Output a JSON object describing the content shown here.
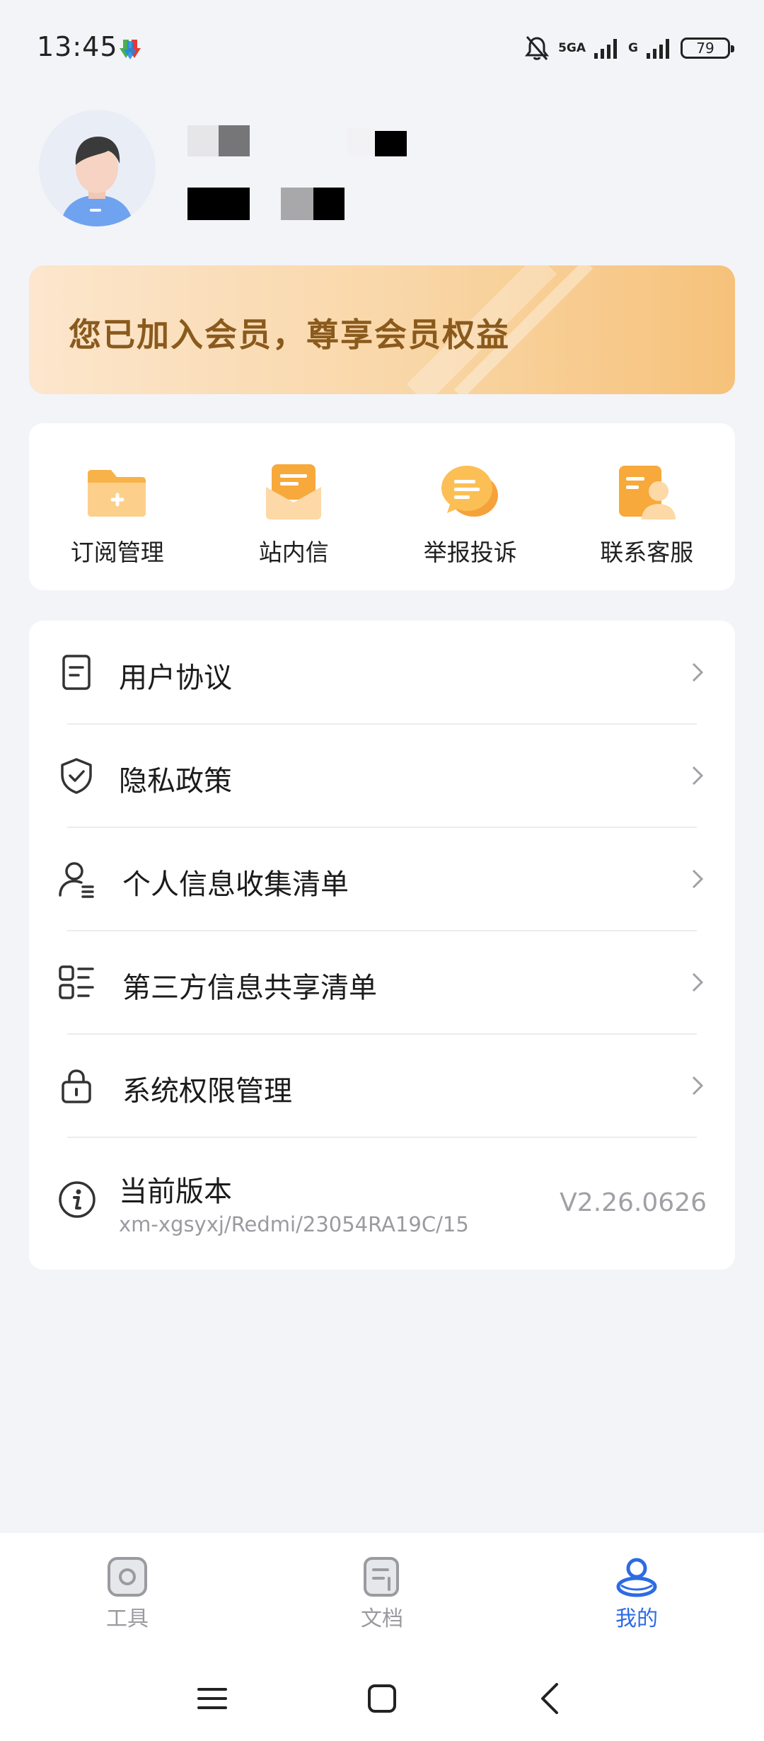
{
  "status_bar": {
    "time": "13:45",
    "network": "5GA",
    "network2": "G",
    "battery": "79",
    "icons": [
      "download-app-icon",
      "bell-mute-icon",
      "signal-icon",
      "battery-icon"
    ]
  },
  "vip": {
    "text": "您已加入会员，尊享会员权益"
  },
  "quick_actions": [
    {
      "label": "订阅管理",
      "icon": "folder-add-icon"
    },
    {
      "label": "站内信",
      "icon": "mail-icon"
    },
    {
      "label": "举报投诉",
      "icon": "chat-bubble-icon"
    },
    {
      "label": "联系客服",
      "icon": "customer-service-icon"
    }
  ],
  "menu": [
    {
      "label": "用户协议",
      "icon": "document-icon"
    },
    {
      "label": "隐私政策",
      "icon": "shield-check-icon"
    },
    {
      "label": "个人信息收集清单",
      "icon": "user-list-icon"
    },
    {
      "label": "第三方信息共享清单",
      "icon": "grid-list-icon"
    },
    {
      "label": "系统权限管理",
      "icon": "lock-icon"
    }
  ],
  "version": {
    "title": "当前版本",
    "subtitle": "xm-xgsyxj/Redmi/23054RA19C/15",
    "value": "V2.26.0626"
  },
  "bottom_nav": [
    {
      "label": "工具",
      "icon": "camera-icon",
      "active": false
    },
    {
      "label": "文档",
      "icon": "document-tab-icon",
      "active": false
    },
    {
      "label": "我的",
      "icon": "user-icon",
      "active": true
    }
  ],
  "colors": {
    "accent": "#2d6be4",
    "vip_text": "#8a5a1d",
    "background": "#f3f4f8",
    "icon_orange": "#f7a93b"
  }
}
